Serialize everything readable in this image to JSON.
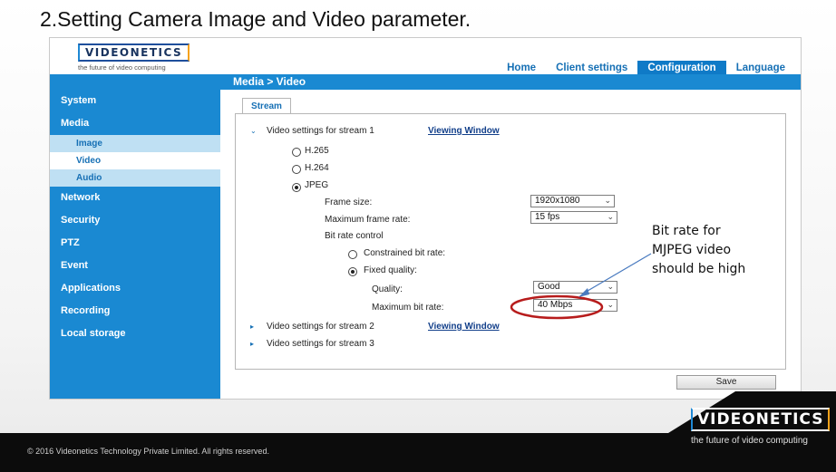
{
  "slide": {
    "title": "2.Setting Camera Image and Video parameter."
  },
  "brand": {
    "name": "VIDEONETICS",
    "tagline": "the future of video computing"
  },
  "top_nav": {
    "items": [
      {
        "label": "Home"
      },
      {
        "label": "Client settings"
      },
      {
        "label": "Configuration",
        "active": true
      },
      {
        "label": "Language"
      }
    ]
  },
  "breadcrumb": "Media  > Video",
  "sidebar": {
    "items": [
      {
        "label": "System"
      },
      {
        "label": "Media"
      },
      {
        "label": "Image",
        "sub": true
      },
      {
        "label": "Video",
        "sub": true,
        "active": true
      },
      {
        "label": "Audio",
        "sub": true
      },
      {
        "label": "Network"
      },
      {
        "label": "Security"
      },
      {
        "label": "PTZ"
      },
      {
        "label": "Event"
      },
      {
        "label": "Applications"
      },
      {
        "label": "Recording"
      },
      {
        "label": "Local storage"
      }
    ]
  },
  "tab": {
    "label": "Stream"
  },
  "stream1": {
    "heading": "Video settings for stream 1",
    "viewing_window": "Viewing Window",
    "codecs": [
      {
        "label": "H.265",
        "selected": false
      },
      {
        "label": "H.264",
        "selected": false
      },
      {
        "label": "JPEG",
        "selected": true
      }
    ],
    "frame_size": {
      "label": "Frame size:",
      "value": "1920x1080"
    },
    "max_frame_rate": {
      "label": "Maximum frame rate:",
      "value": "15 fps"
    },
    "bit_rate_control": {
      "label": "Bit rate control",
      "constrained": {
        "label": "Constrained bit rate:",
        "selected": false
      },
      "fixed_quality": {
        "label": "Fixed quality:",
        "selected": true
      },
      "quality": {
        "label": "Quality:",
        "value": "Good"
      },
      "max_bit_rate": {
        "label": "Maximum bit rate:",
        "value": "40 Mbps"
      }
    }
  },
  "stream2": {
    "heading": "Video settings for stream 2",
    "viewing_window": "Viewing Window"
  },
  "stream3": {
    "heading": "Video settings for stream 3"
  },
  "save_label": "Save",
  "annotation": {
    "lines": [
      "Bit rate for",
      "MJPEG video",
      "should be high"
    ],
    "ellipse_color": "#b71c1c",
    "arrow_color": "#4a7bc0"
  },
  "footer": {
    "copyright": "© 2016 Videonetics Technology Private Limited. All rights reserved.",
    "brand": "VIDEONETICS",
    "tagline": "the future of video computing"
  },
  "colors": {
    "accent_blue": "#1a89d2",
    "nav_active": "#0f7ac7",
    "link_blue": "#1670b5",
    "sub_item_bg": "#bfe0f3"
  }
}
